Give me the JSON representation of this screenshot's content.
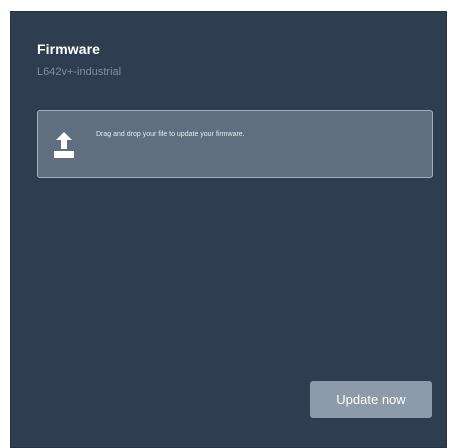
{
  "firmware": {
    "title": "Firmware",
    "model": "L642v+-industrial"
  },
  "dropzone": {
    "icon": "upload-icon",
    "text": "Drag and drop your file to update your firmware."
  },
  "actions": {
    "update_label": "Update now"
  },
  "colors": {
    "panel_bg": "#2e3e50",
    "dropzone_bg": "#5f6f80",
    "button_bg": "#8d9aa9"
  }
}
